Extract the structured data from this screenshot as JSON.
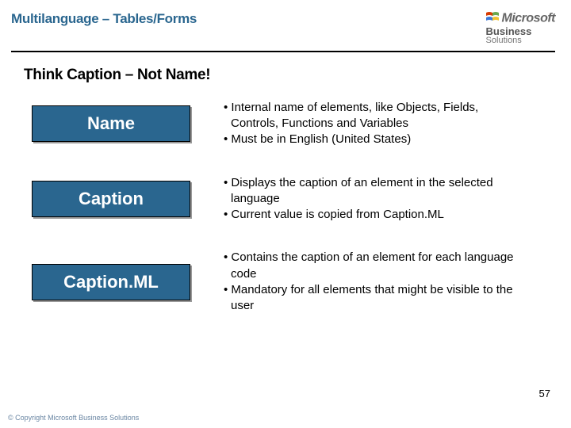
{
  "header": {
    "title": "Multilanguage – Tables/Forms",
    "logo_top": "Microsoft",
    "logo_mid": "Business",
    "logo_sub": "Solutions"
  },
  "subtitle": "Think Caption – Not Name!",
  "rows": [
    {
      "chip": "Name",
      "b1": "• Internal name of elements, like Objects, Fields, Controls, Functions and Variables",
      "b2": "• Must be in English (United States)"
    },
    {
      "chip": "Caption",
      "b1": "• Displays the caption of an element in the selected language",
      "b2": "• Current value is copied from Caption.ML"
    },
    {
      "chip": "Caption.ML",
      "b1": "• Contains the caption of an element for each language code",
      "b2": "• Mandatory for all elements that might be visible to the user"
    }
  ],
  "pagenum": "57",
  "copyright": "© Copyright Microsoft Business Solutions"
}
